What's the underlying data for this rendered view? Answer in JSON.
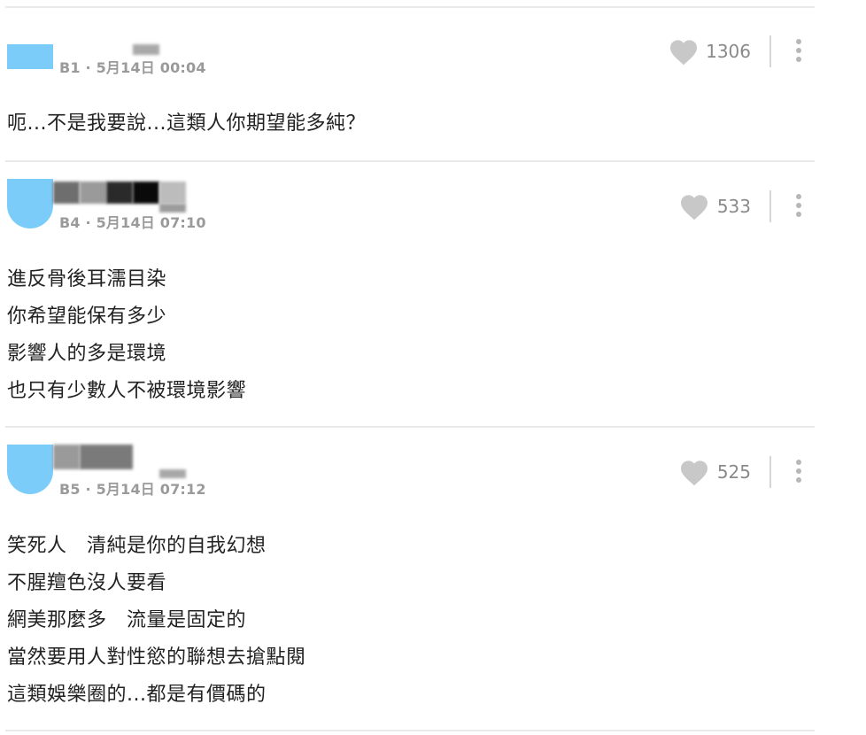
{
  "comments": [
    {
      "floor": "B1",
      "date": "5月14日",
      "time": "00:04",
      "likes": "1306",
      "lines": [
        "呃...不是我要說...這類人你期望能多純？"
      ]
    },
    {
      "floor": "B4",
      "date": "5月14日",
      "time": "07:10",
      "likes": "533",
      "lines": [
        "進反骨後耳濡目染",
        "你希望能保有多少",
        "影響人的多是環境",
        "也只有少數人不被環境影響"
      ]
    },
    {
      "floor": "B5",
      "date": "5月14日",
      "time": "07:12",
      "likes": "525",
      "lines": [
        "笑死人　清純是你的自我幻想",
        "不腥羶色沒人要看",
        "網美那麼多　流量是固定的",
        "當然要用人對性慾的聯想去搶點閱",
        "這類娛樂圈的...都是有價碼的"
      ]
    }
  ],
  "separator": "·",
  "colors": {
    "avatar": "#7cccf9",
    "meta": "#9a9a9a",
    "like_icon": "#c8c8c8",
    "divider": "#e9e9e9"
  },
  "icons": [
    "heart-icon",
    "more-vertical-icon"
  ]
}
